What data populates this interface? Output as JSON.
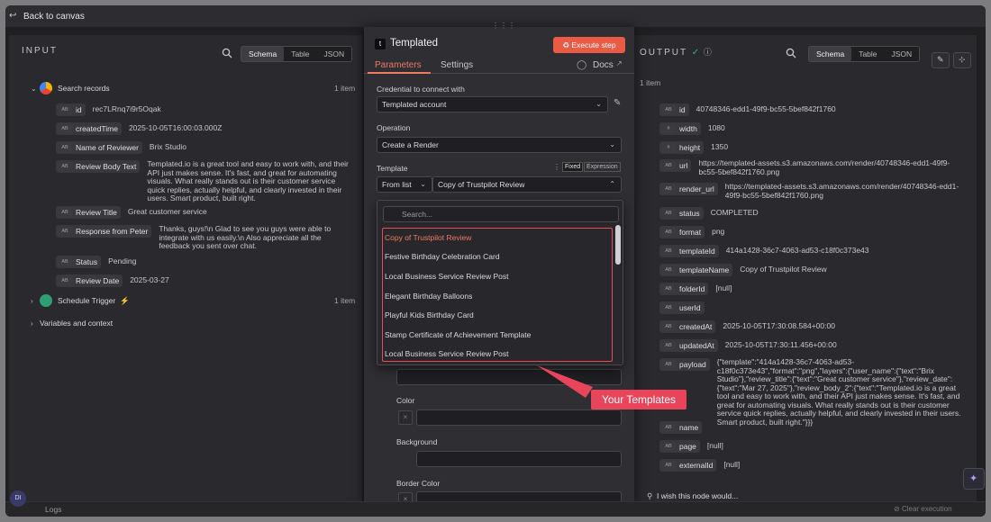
{
  "topbar": {
    "back_label": "Back to canvas"
  },
  "input": {
    "title": "INPUT",
    "tabs": [
      "Schema",
      "Table",
      "JSON"
    ],
    "search_node": {
      "label": "Search records",
      "count": "1 item"
    },
    "fields": [
      {
        "type": "AB",
        "name": "id",
        "value": "rec7LRnq7i9r5Oqak"
      },
      {
        "type": "AB",
        "name": "createdTime",
        "value": "2025-10-05T16:00:03.000Z"
      },
      {
        "type": "AB",
        "name": "Name of Reviewer",
        "value": "Brix Studio"
      },
      {
        "type": "AB",
        "name": "Review Body Text",
        "value": "Templated.io is a great tool and easy to work with, and their API just makes sense. It's fast, and great for automating visuals. What really stands out is their customer service quick replies, actually helpful, and clearly invested in their users. Smart product, built right."
      },
      {
        "type": "AB",
        "name": "Review Title",
        "value": "Great customer service"
      },
      {
        "type": "AB",
        "name": "Response from Peter",
        "value": "Thanks, guys!\\n Glad to see you guys were able to integrate with us easily.\\n Also appreciate all the feedback you sent over chat."
      },
      {
        "type": "AB",
        "name": "Status",
        "value": "Pending"
      },
      {
        "type": "AB",
        "name": "Review Date",
        "value": "2025-03-27"
      }
    ],
    "schedule_node": {
      "label": "Schedule Trigger",
      "count": "1 item"
    },
    "variables_label": "Variables and context"
  },
  "modal": {
    "icon_letter": "t",
    "title": "Templated",
    "execute_label": "Execute step",
    "tabs": {
      "parameters": "Parameters",
      "settings": "Settings",
      "docs": "Docs"
    },
    "credential_label": "Credential to connect with",
    "credential_value": "Templated account",
    "operation_label": "Operation",
    "operation_value": "Create a Render",
    "template_label": "Template",
    "badge_fixed": "Fixed",
    "badge_expression": "Expression",
    "template_mode": "From list",
    "template_value": "Copy of Trustpilot Review",
    "color_label": "Color",
    "background_label": "Background",
    "border_color_label": "Border Color"
  },
  "dropdown": {
    "search_placeholder": "Search...",
    "items": [
      "Copy of Trustpilot Review",
      "Festive Birthday Celebration Card",
      "Local Business Service Review Post",
      "Elegant Birthday Balloons",
      "Playful Kids Birthday Card",
      "Stamp Certificate of Achievement Template",
      "Local Business Service Review Post"
    ]
  },
  "callout": "Your Templates",
  "output": {
    "title": "OUTPUT",
    "count": "1 item",
    "tabs": [
      "Schema",
      "Table",
      "JSON"
    ],
    "fields": [
      {
        "type": "AB",
        "name": "id",
        "value": "40748346-edd1-49f9-bc55-5bef842f1760"
      },
      {
        "type": "#",
        "name": "width",
        "value": "1080"
      },
      {
        "type": "#",
        "name": "height",
        "value": "1350"
      },
      {
        "type": "AB",
        "name": "url",
        "value": "https://templated-assets.s3.amazonaws.com/render/40748346-edd1-49f9-bc55-5bef842f1760.png"
      },
      {
        "type": "AB",
        "name": "render_url",
        "value": "https://templated-assets.s3.amazonaws.com/render/40748346-edd1-49f9-bc55-5bef842f1760.png"
      },
      {
        "type": "AB",
        "name": "status",
        "value": "COMPLETED"
      },
      {
        "type": "AB",
        "name": "format",
        "value": "png"
      },
      {
        "type": "AB",
        "name": "templateId",
        "value": "414a1428-36c7-4063-ad53-c18f0c373e43"
      },
      {
        "type": "AB",
        "name": "templateName",
        "value": "Copy of Trustpilot Review"
      },
      {
        "type": "AB",
        "name": "folderId",
        "value": "[null]"
      },
      {
        "type": "AB",
        "name": "userId",
        "value": ""
      },
      {
        "type": "AB",
        "name": "createdAt",
        "value": "2025-10-05T17:30:08.584+00:00"
      },
      {
        "type": "AB",
        "name": "updatedAt",
        "value": "2025-10-05T17:30:11.456+00:00"
      },
      {
        "type": "AB",
        "name": "payload",
        "value": "{\"template\":\"414a1428-36c7-4063-ad53-c18f0c373e43\",\"format\":\"png\",\"layers\":{\"user_name\":{\"text\":\"Brix Studio\"},\"review_title\":{\"text\":\"Great customer service\"},\"review_date\":{\"text\":\"Mar 27, 2025\"},\"review_body_2\":{\"text\":\"Templated.io is a great tool and easy to work with, and their API just makes sense. It's fast, and great for automating visuals. What really stands out is their customer service quick replies, actually helpful, and clearly invested in their users. Smart product, built right.\"}}}"
      },
      {
        "type": "AB",
        "name": "name",
        "value": ""
      },
      {
        "type": "AB",
        "name": "page",
        "value": "[null]"
      },
      {
        "type": "AB",
        "name": "externalId",
        "value": "[null]"
      }
    ]
  },
  "bottom": {
    "logs_label": "Logs",
    "clear_label": "Clear execution",
    "wish_text": "I wish this node would...",
    "avatar_initials": "DI"
  }
}
